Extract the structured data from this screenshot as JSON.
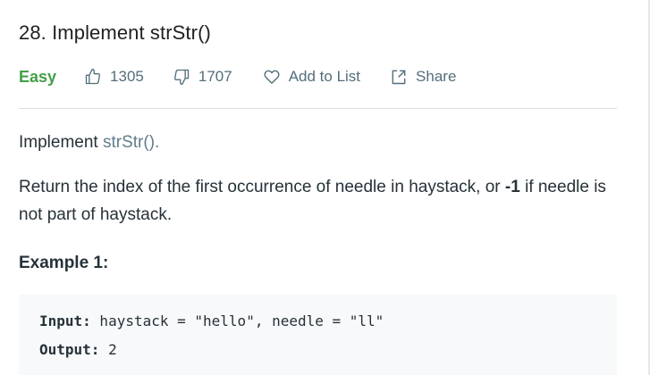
{
  "problem": {
    "title": "28. Implement strStr()",
    "difficulty": "Easy",
    "likes": "1305",
    "dislikes": "1707",
    "add_to_list_label": "Add to List",
    "share_label": "Share"
  },
  "description": {
    "intro_prefix": "Implement ",
    "intro_link": "strStr()",
    "intro_suffix": ".",
    "return_text_1": "Return the index of the first occurrence of needle in haystack, or ",
    "return_bold": "-1",
    "return_text_2": " if needle is not part of haystack."
  },
  "example": {
    "title": "Example 1:",
    "input_label": "Input:",
    "input_value": " haystack = \"hello\", needle = \"ll\"",
    "output_label": "Output:",
    "output_value": " 2"
  },
  "colors": {
    "difficulty_easy": "#43a047",
    "link": "#607d8b",
    "meta_text": "#546e7a",
    "code_bg": "#f7f9fa"
  },
  "icons": {
    "like": "thumbs-up-icon",
    "dislike": "thumbs-down-icon",
    "add_to_list": "heart-icon",
    "share": "share-icon"
  }
}
